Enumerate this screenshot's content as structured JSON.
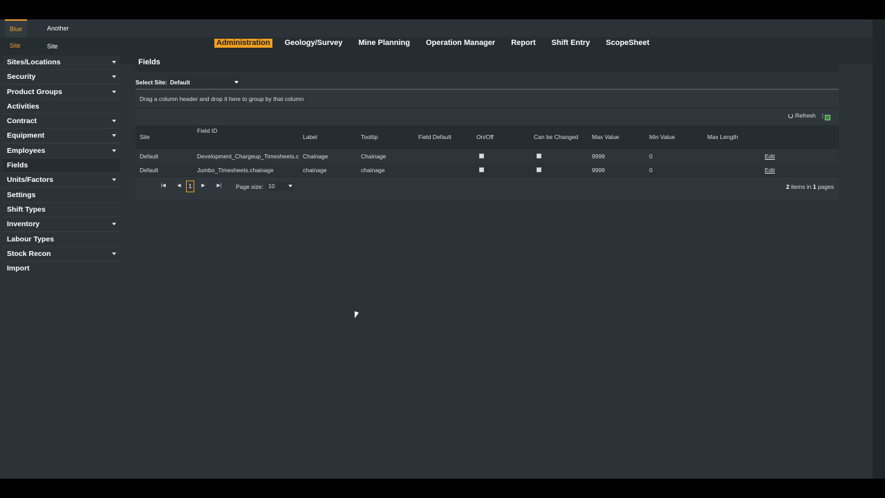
{
  "site_tabs": [
    {
      "label": "Blue Site",
      "active": true
    },
    {
      "label": "Another Site",
      "active": false
    }
  ],
  "main_nav": [
    {
      "label": "Administration",
      "active": true
    },
    {
      "label": "Geology/Survey",
      "active": false
    },
    {
      "label": "Mine Planning",
      "active": false
    },
    {
      "label": "Operation Manager",
      "active": false
    },
    {
      "label": "Report",
      "active": false
    },
    {
      "label": "Shift Entry",
      "active": false
    },
    {
      "label": "ScopeSheet",
      "active": false
    }
  ],
  "sidebar": {
    "items": [
      {
        "label": "Sites/Locations",
        "expandable": true
      },
      {
        "label": "Security",
        "expandable": true
      },
      {
        "label": "Product Groups",
        "expandable": true
      },
      {
        "label": "Activities",
        "expandable": false
      },
      {
        "label": "Contract",
        "expandable": true
      },
      {
        "label": "Equipment",
        "expandable": true
      },
      {
        "label": "Employees",
        "expandable": true
      },
      {
        "label": "Fields",
        "expandable": false,
        "selected": true
      },
      {
        "label": "Units/Factors",
        "expandable": true
      },
      {
        "label": "Settings",
        "expandable": false
      },
      {
        "label": "Shift Types",
        "expandable": false
      },
      {
        "label": "Inventory",
        "expandable": true
      },
      {
        "label": "Labour Types",
        "expandable": false
      },
      {
        "label": "Stock Recon",
        "expandable": true
      },
      {
        "label": "Import",
        "expandable": false
      }
    ]
  },
  "page": {
    "title": "Fields",
    "select_site_label": "Select Site:",
    "select_site_value": "Default"
  },
  "grid": {
    "group_hint": "Drag a column header and drop it here to group by that column",
    "refresh_label": "Refresh",
    "toolbar_separator": "|",
    "columns": [
      "Site",
      "Field ID",
      "Label",
      "Tooltip",
      "Field Default",
      "On/Off",
      "Can be Changed",
      "Max Value",
      "Min Value",
      "Max Length"
    ],
    "rows": [
      {
        "site": "Default",
        "field_id": "Development_Chargeup_Timesheets.c",
        "label": "Chainage",
        "tooltip": "Chainage",
        "field_default": "",
        "on_off": true,
        "can_change": true,
        "max_value": "9999",
        "min_value": "0",
        "max_length": "",
        "action": "Edit"
      },
      {
        "site": "Default",
        "field_id": "Jumbo_Timesheets.chainage",
        "label": "chainage",
        "tooltip": "chainage",
        "field_default": "",
        "on_off": true,
        "can_change": true,
        "max_value": "9999",
        "min_value": "0",
        "max_length": "",
        "action": "Edit"
      }
    ],
    "pager": {
      "current_page": "1",
      "page_size_label": "Page size:",
      "page_size": "10",
      "info_count": "2",
      "info_mid": "items in",
      "info_pages": "1",
      "info_end": "pages"
    }
  },
  "colors": {
    "accent": "#f0a020",
    "background": "#2b3338"
  }
}
